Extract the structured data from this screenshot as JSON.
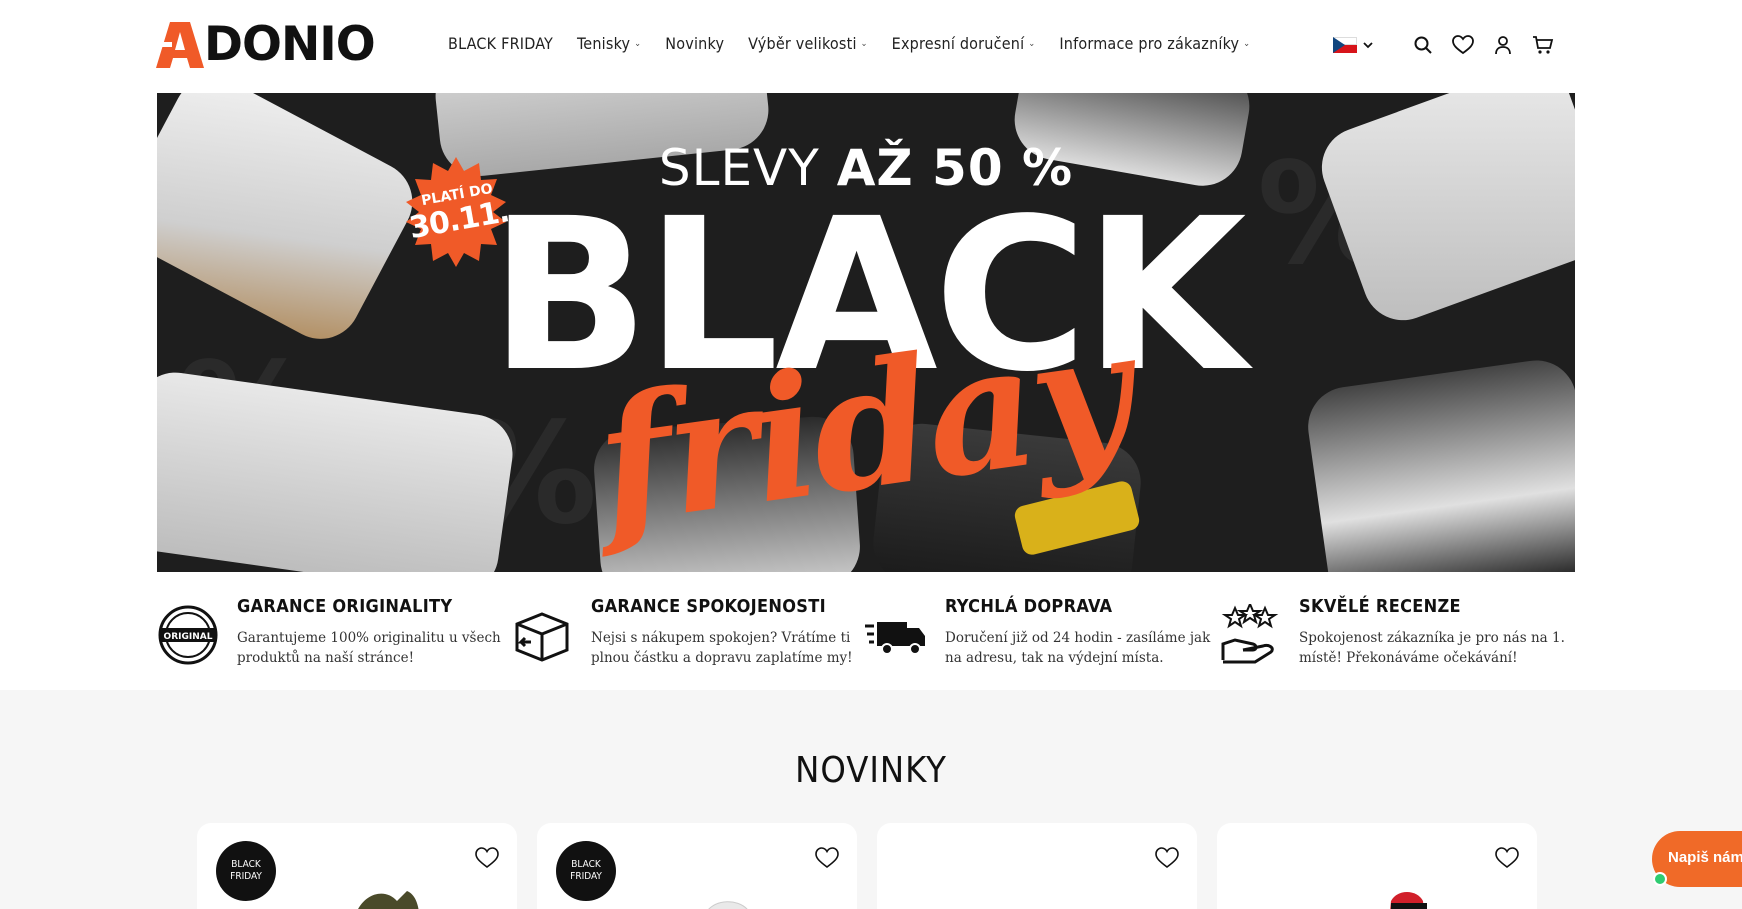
{
  "header": {
    "logo_text": "DONIO",
    "nav": [
      {
        "label": "BLACK FRIDAY",
        "dropdown": false
      },
      {
        "label": "Tenisky",
        "dropdown": true
      },
      {
        "label": "Novinky",
        "dropdown": false
      },
      {
        "label": "Výběr velikosti",
        "dropdown": true
      },
      {
        "label": "Expresní doručení",
        "dropdown": true
      },
      {
        "label": "Informace pro zákazníky",
        "dropdown": true
      }
    ],
    "language": "cz-flag",
    "icons": [
      "search-icon",
      "heart-icon",
      "user-icon",
      "cart-icon"
    ]
  },
  "hero": {
    "subtitle_light": "SLEVY ",
    "subtitle_bold": "AŽ 50 %",
    "title": "BLACK",
    "script": "friday",
    "badge_line1": "PLATÍ DO",
    "badge_line2": "30.11."
  },
  "features": [
    {
      "title": "GARANCE ORIGINALITY",
      "desc": "Garantujeme 100% originalitu u všech produktů na naší stránce!",
      "icon": "original-seal-icon"
    },
    {
      "title": "GARANCE SPOKOJENOSTI",
      "desc": "Nejsi s nákupem spokojen? Vrátíme ti plnou částku a dopravu zaplatíme my!",
      "icon": "return-box-icon"
    },
    {
      "title": "RYCHLÁ DOPRAVA",
      "desc": "Doručení již od 24 hodin - zasíláme jak na adresu, tak na výdejní místa.",
      "icon": "delivery-truck-icon"
    },
    {
      "title": "SKVĚLÉ RECENZE",
      "desc": "Spokojenost zákazníka je pro nás na 1. místě! Překonáváme očekávání!",
      "icon": "stars-hand-icon"
    }
  ],
  "section": {
    "title": "NOVINKY",
    "cards": [
      {
        "badge": "BLACK\nFRIDAY",
        "has_badge": true
      },
      {
        "badge": "BLACK\nFRIDAY",
        "has_badge": true
      },
      {
        "badge": "",
        "has_badge": false
      },
      {
        "badge": "",
        "has_badge": false
      }
    ]
  },
  "chat": {
    "label": "Napiš nám"
  },
  "colors": {
    "accent": "#f05a28",
    "dark": "#1e1e1e"
  }
}
